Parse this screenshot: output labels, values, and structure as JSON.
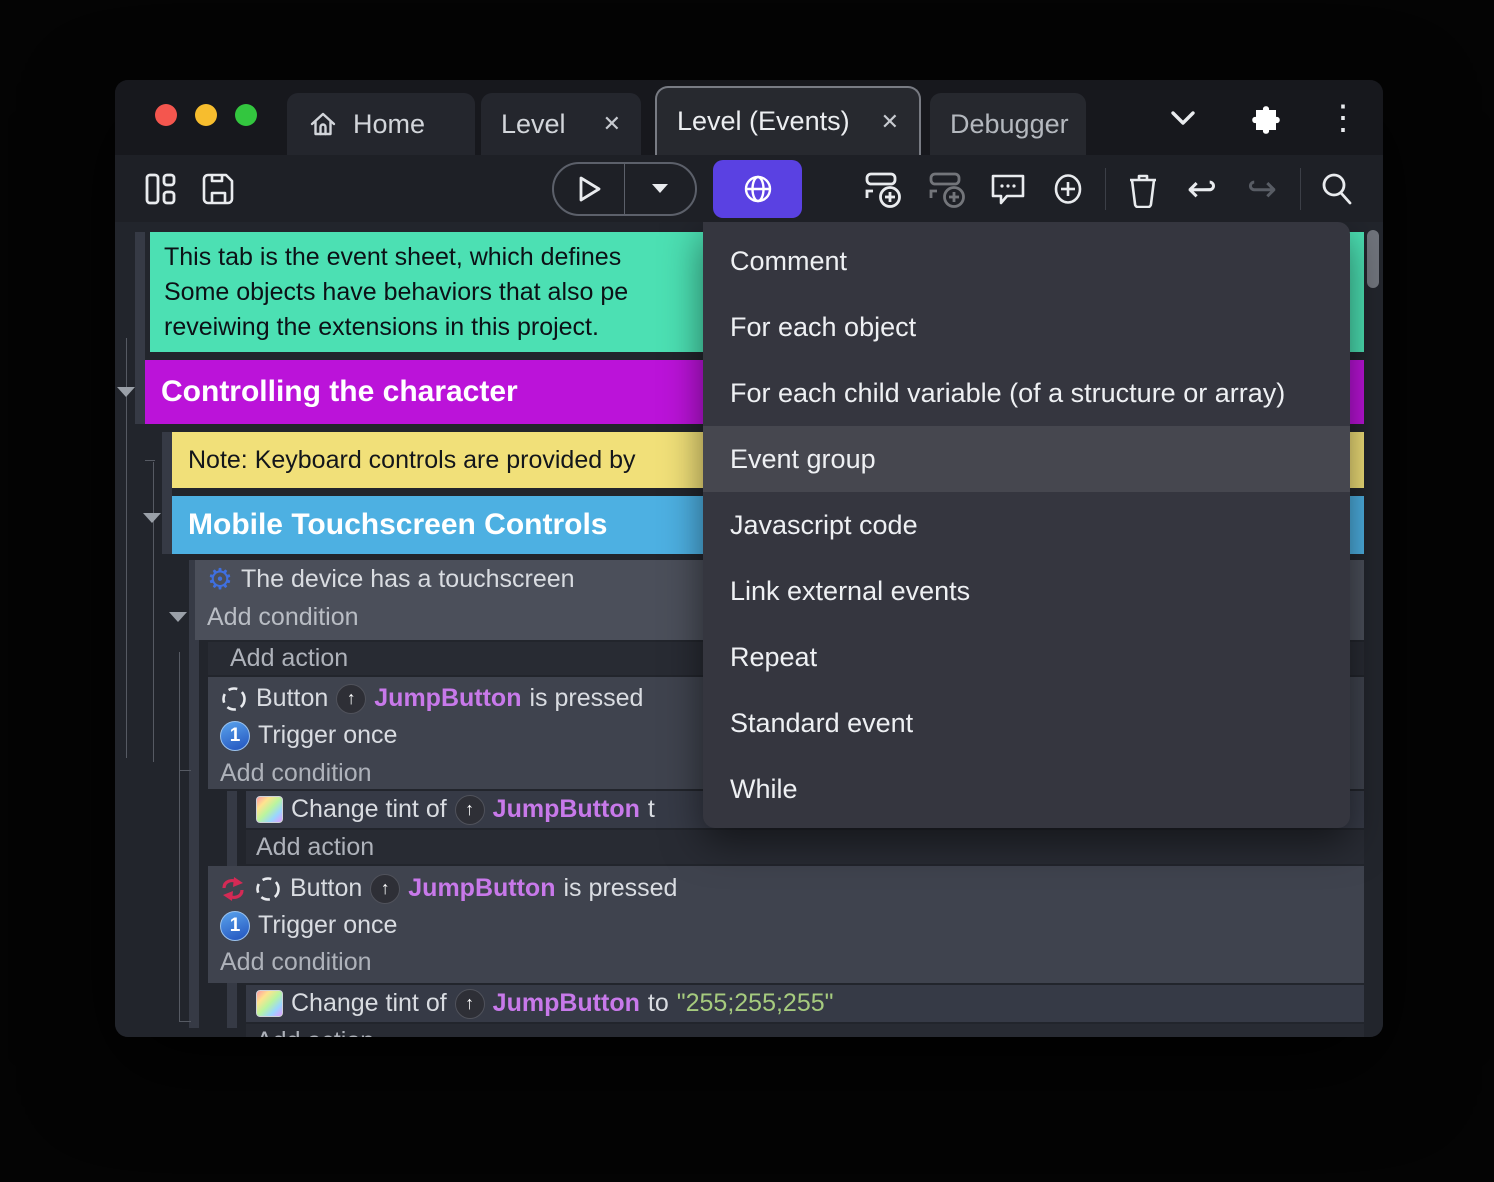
{
  "window": {
    "tabs": {
      "home": "Home",
      "level": "Level",
      "level_events": "Level (Events)",
      "debugger": "Debugger"
    },
    "close_glyph": "✕",
    "kebab_glyph": "⋮"
  },
  "toolbar": {
    "undo_glyph": "↩",
    "redo_glyph": "↪",
    "accent_button_color": "#5a41e2"
  },
  "menu": {
    "items": [
      "Comment",
      "For each object",
      "For each child variable (of a structure or array)",
      "Event group",
      "Javascript code",
      "Link external events",
      "Repeat",
      "Standard event",
      "While"
    ],
    "highlighted_item": "Event group"
  },
  "sheet": {
    "comment": {
      "line1": "This tab is the event sheet, which defines",
      "line2": "Some objects have behaviors that also pe",
      "line3": "reveiwing the extensions in this project."
    },
    "group1": "Controlling the character",
    "note": "Note: Keyboard controls are provided by",
    "group2": "Mobile Touchscreen Controls",
    "condition_block": {
      "text": "The device has a touchscreen",
      "add_condition": "Add condition"
    },
    "add_action": "Add action",
    "add_condition": "Add condition",
    "event1": {
      "object": "Button",
      "target": "JumpButton",
      "suffix": "is pressed",
      "trigger": "Trigger once",
      "trigger_glyph": "1",
      "arrow_glyph": "↑"
    },
    "tint1": {
      "prefix": "Change tint of",
      "target": "JumpButton",
      "suffix": "t"
    },
    "event2": {
      "object": "Button",
      "target": "JumpButton",
      "suffix": "is pressed",
      "trigger": "Trigger once",
      "trigger_glyph": "1",
      "arrow_glyph": "↑"
    },
    "tint2": {
      "prefix": "Change tint of",
      "target": "JumpButton",
      "to": "to",
      "value": "\"255;255;255\""
    }
  },
  "colors": {
    "comment_bg": "#4ce0b3",
    "group1_bg": "#bb13d9",
    "note_bg": "#f1e079",
    "group2_bg": "#4db0e2",
    "accent": "#5a41e2",
    "object_text": "#c879ea",
    "value_text": "#a6cb7e",
    "menu_bg": "#35363f",
    "menu_highlight": "#46474f"
  }
}
